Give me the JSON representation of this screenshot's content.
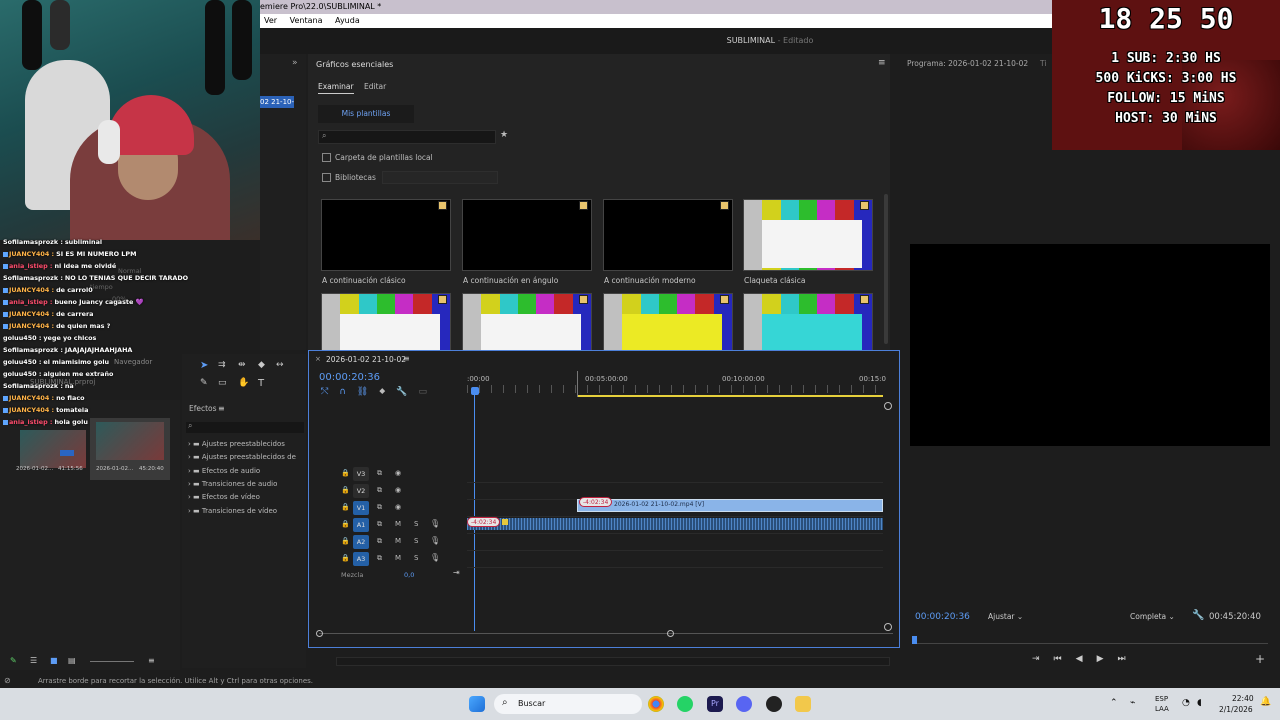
{
  "window": {
    "title": "emiere Pro\\22.0\\SUBLIMINAL *",
    "menu": [
      "Ver",
      "Ventana",
      "Ayuda"
    ]
  },
  "project": {
    "name": "SUBLIMINAL",
    "state": "Editado",
    "date_tag": "02 21-10-"
  },
  "overlay": {
    "clock": "18 25 50",
    "lines": [
      "1 SUB: 2:30 HS",
      "500 KiCKS: 3:00 HS",
      "FOLLOW: 15 MiNS",
      "HOST: 30 MiNS"
    ]
  },
  "chat": [
    {
      "user": "Sofilamasprozk",
      "msg": "subliminal",
      "color": "#ffffff"
    },
    {
      "user": "JUANCY404",
      "msg": "SI ES MI NUMERO LPM",
      "color": "#ffb347"
    },
    {
      "user": "ania_istiep",
      "msg": "ni idea me olvidé",
      "color": "#ff4d6d"
    },
    {
      "user": "Sofilamasprozk",
      "msg": "NO LO TENIAS QUE DECIR TARADO",
      "color": "#ffffff"
    },
    {
      "user": "JUANCY404",
      "msg": "de carrol0",
      "color": "#ffb347"
    },
    {
      "user": "ania_istiep",
      "msg": "bueno Juancy cagaste 💜",
      "color": "#ff4d6d"
    },
    {
      "user": "JUANCY404",
      "msg": "de carrera",
      "color": "#ffb347"
    },
    {
      "user": "JUANCY404",
      "msg": "de quien mas ?",
      "color": "#ffb347"
    },
    {
      "user": "goluu450",
      "msg": "yege yo chicos",
      "color": "#ffffff"
    },
    {
      "user": "Sofilamasprozk",
      "msg": "JAAJAJAJHAAHJAHA",
      "color": "#ffffff"
    },
    {
      "user": "goluu450",
      "msg": "el miamisimo golu",
      "color": "#ffffff"
    },
    {
      "user": "goluu450",
      "msg": "alguien me extraño",
      "color": "#ffffff"
    },
    {
      "user": "Sofilamasprozk",
      "msg": "na",
      "color": "#ffffff"
    },
    {
      "user": "JUANCY404",
      "msg": "no flaco",
      "color": "#ffb347"
    },
    {
      "user": "JUANCY404",
      "msg": "tomatela",
      "color": "#ffb347"
    },
    {
      "user": "ania_istiep",
      "msg": "hola golu",
      "color": "#ff4d6d"
    }
  ],
  "essential_graphics": {
    "title": "Gráficos esenciales",
    "tabs": [
      "Examinar",
      "Editar"
    ],
    "my_templates": "Mis plantillas",
    "local_folder": "Carpeta de plantillas local",
    "libraries": "Bibliotecas",
    "templates": [
      {
        "name": "A continuación clásico",
        "style": "black"
      },
      {
        "name": "A continuación en ángulo",
        "style": "black"
      },
      {
        "name": "A continuación moderno",
        "style": "black"
      },
      {
        "name": "Claqueta clásica",
        "style": "bars"
      },
      {
        "name": "",
        "style": "bars"
      },
      {
        "name": "",
        "style": "bars"
      },
      {
        "name": "",
        "style": "yellow"
      },
      {
        "name": "",
        "style": "cyan"
      }
    ]
  },
  "program_monitor": {
    "title": "Programa: 2026-01-02 21-10-02",
    "timecode": "00:00:20:36",
    "fit": "Ajustar",
    "quality": "Completa",
    "duration": "00:45:20:40"
  },
  "timeline": {
    "sequence": "2026-01-02 21-10-02",
    "timecode": "00:00:20:36",
    "ruler": [
      ":00:00",
      "00:05:00:00",
      "00:10:00:00",
      "00:15:0"
    ],
    "video_tracks": [
      "V3",
      "V2",
      "V1"
    ],
    "audio_tracks": [
      "A1",
      "A2",
      "A3"
    ],
    "mix_label": "Mezcla",
    "mix_value": "0,0",
    "clip_name": "2026-01-02 21-10-02.mp4 [V]",
    "clip_badge": "-4:02:34"
  },
  "effects": {
    "title": "Efectos",
    "items": [
      "Ajustes preestablecidos",
      "Ajustes preestablecidos de",
      "Efectos de audio",
      "Transiciones de audio",
      "Efectos de vídeo",
      "Transiciones de vídeo"
    ]
  },
  "project_panel": {
    "navigator": "Navegador",
    "file": "SUBLIMINAL.prproj",
    "clips": [
      {
        "name": "2026-01-02...",
        "duration": "41:15:56"
      },
      {
        "name": "2026-01-02...",
        "duration": "45:20:40"
      }
    ]
  },
  "ghost": {
    "normal": "Normal",
    "tiempo": "tiempo",
    "percent": "00%"
  },
  "status": "Arrastre borde para recortar la selección. Utilice Alt y Ctrl para otras opciones.",
  "taskbar": {
    "search": "Buscar",
    "lang": "ESP",
    "lang2": "LAA",
    "time": "22:40",
    "date": "2/1/2026"
  }
}
